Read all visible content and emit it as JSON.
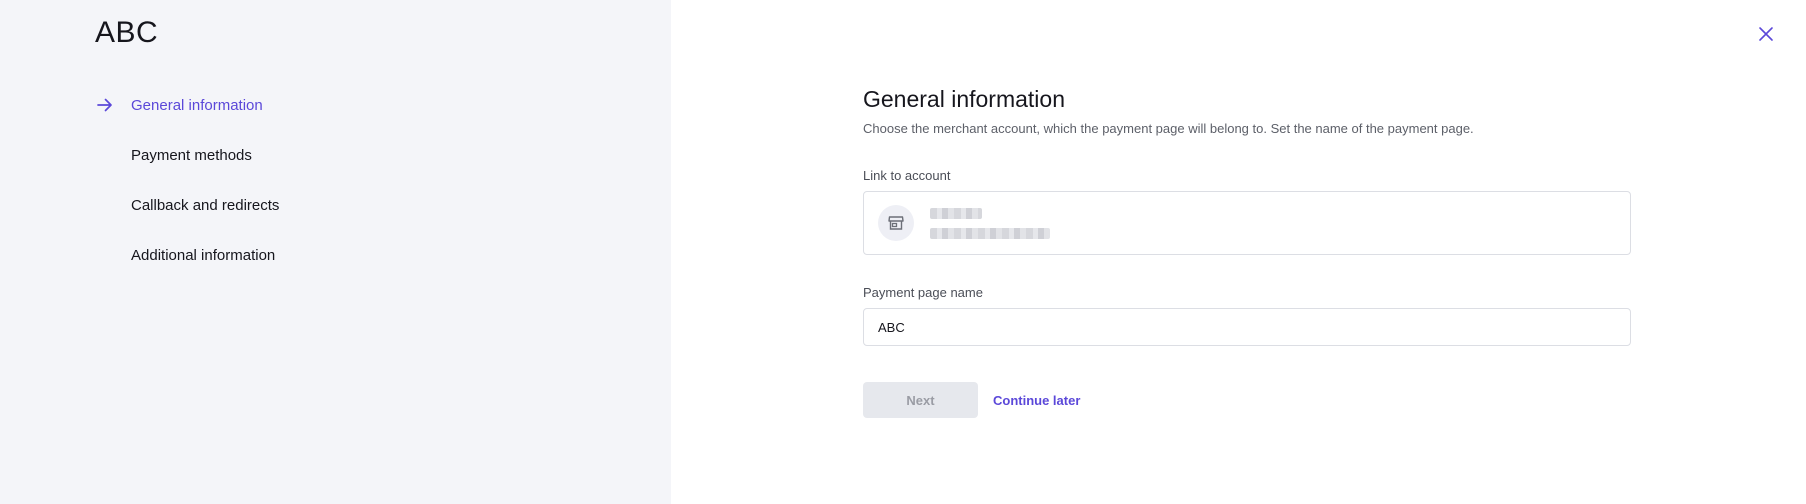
{
  "sidebar": {
    "title": "ABC",
    "steps": [
      {
        "label": "General information",
        "active": true,
        "icon": "arrow-right-icon"
      },
      {
        "label": "Payment methods",
        "active": false
      },
      {
        "label": "Callback and redirects",
        "active": false
      },
      {
        "label": "Additional information",
        "active": false
      }
    ]
  },
  "main": {
    "close_icon": "close-icon",
    "title": "General information",
    "subtitle": "Choose the merchant account, which the payment page will belong to. Set the name of the payment page.",
    "account": {
      "label": "Link to account",
      "icon": "store-icon"
    },
    "page_name": {
      "label": "Payment page name",
      "value": "ABC"
    },
    "actions": {
      "next_label": "Next",
      "continue_label": "Continue later"
    }
  },
  "colors": {
    "accent": "#5b48d9",
    "sidebar_bg": "#f4f5f9",
    "disabled_button_bg": "#e6e8ed"
  }
}
